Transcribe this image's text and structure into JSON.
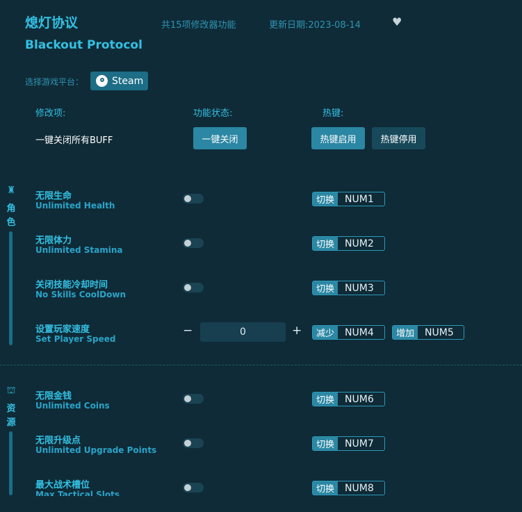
{
  "header": {
    "title_cn": "熄灯协议",
    "title_en": "Blackout Protocol",
    "feature_count": "共15项修改器功能",
    "update_date": "更新日期:2023-08-14",
    "favorite_icon": "heart-icon"
  },
  "platform": {
    "label": "选择游戏平台：",
    "steam_label": "Steam",
    "steam_icon": "steam-icon"
  },
  "columns": {
    "mod": "修改项:",
    "status": "功能状态:",
    "hotkey": "热键:"
  },
  "oneclick": {
    "label": "一键关闭所有BUFF",
    "close_button": "一键关闭",
    "hotkey_enable": "热键启用",
    "hotkey_disable": "热键停用"
  },
  "sections": {
    "character": {
      "label": "角色",
      "icon": "character-icon"
    },
    "resource": {
      "label": "资源",
      "icon": "resource-icon"
    }
  },
  "mods": [
    {
      "cn": "无限生命",
      "en": "Unlimited Health",
      "key_tag": "切换",
      "key": "NUM1"
    },
    {
      "cn": "无限体力",
      "en": "Unlimited Stamina",
      "key_tag": "切换",
      "key": "NUM2"
    },
    {
      "cn": "关闭技能冷却时间",
      "en": "No Skills CoolDown",
      "key_tag": "切换",
      "key": "NUM3"
    },
    {
      "cn": "设置玩家速度",
      "en": "Set Player Speed",
      "value": "0",
      "minus": "−",
      "plus": "+",
      "dec_tag": "减少",
      "dec_key": "NUM4",
      "inc_tag": "增加",
      "inc_key": "NUM5"
    },
    {
      "cn": "无限金钱",
      "en": "Unlimited Coins",
      "key_tag": "切换",
      "key": "NUM6"
    },
    {
      "cn": "无限升级点",
      "en": "Unlimited Upgrade Points",
      "key_tag": "切换",
      "key": "NUM7"
    },
    {
      "cn": "最大战术槽位",
      "en": "Max Tactical Slots",
      "key_tag": "切换",
      "key": "NUM8"
    }
  ]
}
